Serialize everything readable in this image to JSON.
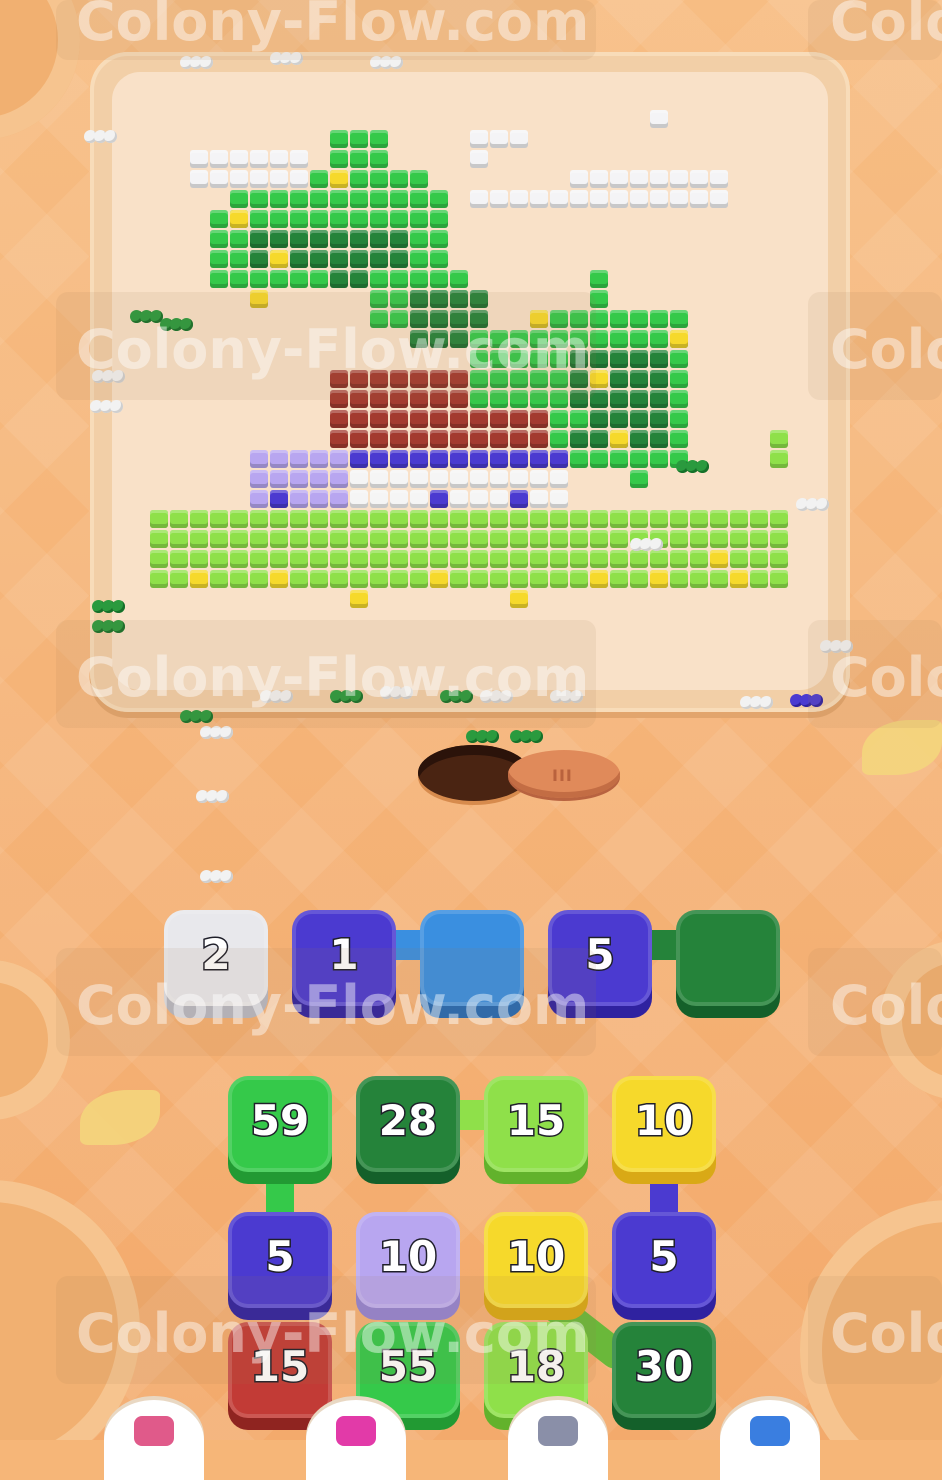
{
  "watermark": {
    "text": "Colony-Flow.com"
  },
  "selection_row": [
    {
      "value": "2",
      "color": "#e8e8ec",
      "shadow": "#b7b8c2"
    },
    {
      "value": "1",
      "color": "#4b3ad0",
      "shadow": "#2f22a0"
    },
    {
      "value": "",
      "color": "#3a8fe0",
      "shadow": "#2569b3"
    },
    {
      "value": "5",
      "color": "#4b3ad0",
      "shadow": "#2f22a0"
    },
    {
      "value": "",
      "color": "#25833a",
      "shadow": "#14602a"
    },
    {
      "value": "",
      "color": "empty",
      "shadow": ""
    }
  ],
  "queue_rows": [
    [
      {
        "value": "59",
        "color": "#35c94a",
        "shadow": "#229a33"
      },
      {
        "value": "28",
        "color": "#25833a",
        "shadow": "#14602a"
      },
      {
        "value": "15",
        "color": "#8fe04a",
        "shadow": "#62b22c"
      },
      {
        "value": "10",
        "color": "#f6d92b",
        "shadow": "#d9a916"
      }
    ],
    [
      {
        "value": "5",
        "color": "#4b3ad0",
        "shadow": "#2f22a0"
      },
      {
        "value": "10",
        "color": "#b8a6f0",
        "shadow": "#9584d2"
      },
      {
        "value": "10",
        "color": "#f6d92b",
        "shadow": "#d9a916"
      },
      {
        "value": "5",
        "color": "#4b3ad0",
        "shadow": "#2f22a0"
      }
    ],
    [
      {
        "value": "15",
        "color": "#c23b36",
        "shadow": "#8f2420"
      },
      {
        "value": "55",
        "color": "#35c94a",
        "shadow": "#229a33"
      },
      {
        "value": "18",
        "color": "#8fe04a",
        "shadow": "#62b22c"
      },
      {
        "value": "30",
        "color": "#25833a",
        "shadow": "#14602a"
      }
    ]
  ],
  "boosters": [
    {
      "icon": "eraser-icon",
      "color": "#e05a8a"
    },
    {
      "icon": "shuffle-arrow-icon",
      "color": "#e23aa8"
    },
    {
      "icon": "magnet-icon",
      "color": "#8a8fa8"
    },
    {
      "icon": "heart-icon",
      "color": "#3a7ee0"
    }
  ],
  "colors": {
    "grass_light": "#8fe04a",
    "grass_green": "#35c94a",
    "tree_dark": "#25833a",
    "roof_red": "#a33a2f",
    "wall_white": "#f5f5f5",
    "wall_lavender": "#b8a6f0",
    "trim_blue": "#4b3ad0",
    "flower_yellow": "#f6d92b",
    "cloud": "#f4f4f6"
  }
}
